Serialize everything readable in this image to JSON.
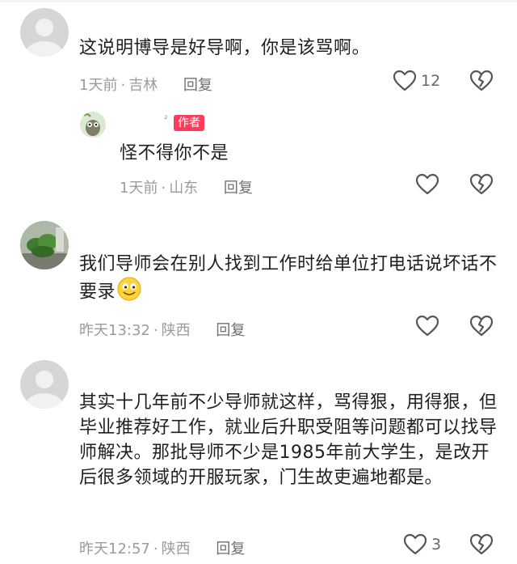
{
  "comments": [
    {
      "text": "这说明博导是好导啊，你是该骂啊。",
      "time": "1天前",
      "location": "吉林",
      "reply_label": "回复",
      "like_count": "12",
      "icons": {
        "like": "heart-outline-icon",
        "dislike": "broken-heart-icon"
      },
      "avatar": "default-avatar"
    },
    {
      "is_author_reply": true,
      "username": "²",
      "badge": "作者",
      "text": "怪不得你不是",
      "time": "1天前",
      "location": "山东",
      "reply_label": "回复",
      "like_count": "",
      "avatar": "cartoon-avatar"
    },
    {
      "text": "我们导师会在别人找到工作时给单位打电话说坏话不要录",
      "emoji": "smiling-emoji-icon",
      "time": "昨天13:32",
      "location": "陕西",
      "reply_label": "回复",
      "like_count": "",
      "avatar": "plant-photo-avatar"
    },
    {
      "text": "其实十几年前不少导师就这样，骂得狠，用得狠，但毕业推荐好工作，就业后升职受阻等问题都可以找导师解决。那批导师不少是1985年前大学生，是改开后很多领域的开服玩家，门生故吏遍地都是。",
      "time": "昨天12:57",
      "location": "陕西",
      "reply_label": "回复",
      "like_count": "3",
      "avatar": "default-avatar"
    }
  ],
  "meta_separator": "·",
  "colors": {
    "badge": "#ff3b5c",
    "meta": "#9b9b9b",
    "text": "#1f1f1f"
  }
}
